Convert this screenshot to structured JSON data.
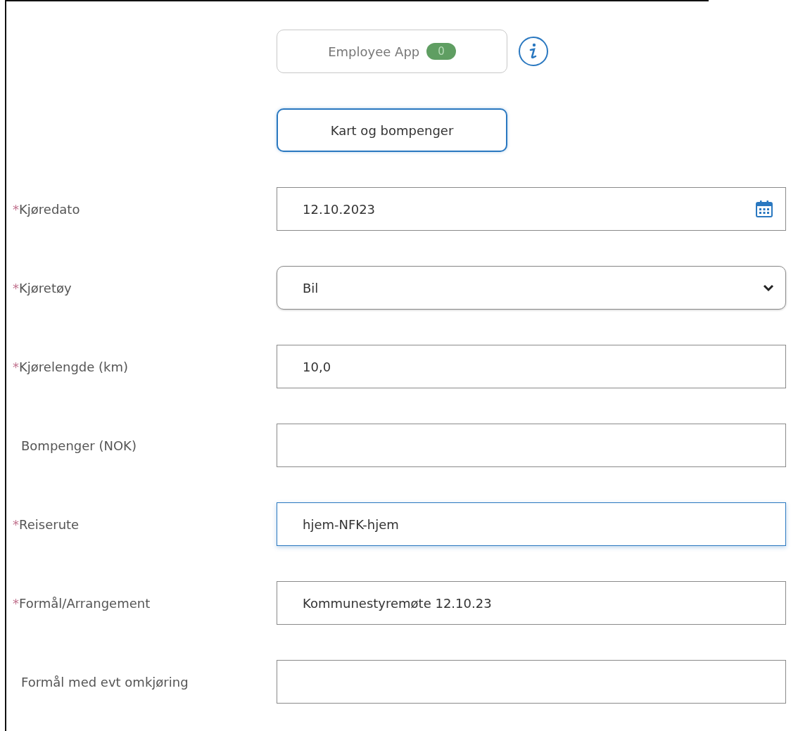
{
  "app_button": {
    "label": "Employee App",
    "badge": "0"
  },
  "map_button": {
    "label": "Kart og bompenger"
  },
  "fields": [
    {
      "label": "Kjøredato",
      "required_mark": "*",
      "kind": "date",
      "value": "12.10.2023",
      "focused": false
    },
    {
      "label": "Kjøretøy",
      "required_mark": "*",
      "kind": "select",
      "value": "Bil",
      "focused": false
    },
    {
      "label": "Kjørelengde (km)",
      "required_mark": "*",
      "kind": "text",
      "value": "10,0",
      "focused": false
    },
    {
      "label": "Bompenger (NOK)",
      "kind": "text",
      "focused": false
    },
    {
      "label": "Reiserute",
      "required_mark": "*",
      "kind": "text",
      "value": "hjem-NFK-hjem",
      "focused": true
    },
    {
      "label": "Formål/Arrangement",
      "required_mark": "*",
      "kind": "text",
      "value": "Kommunestyremøte 12.10.23",
      "focused": false
    },
    {
      "label": "Formål med evt omkjøring",
      "kind": "text",
      "focused": false
    }
  ]
}
